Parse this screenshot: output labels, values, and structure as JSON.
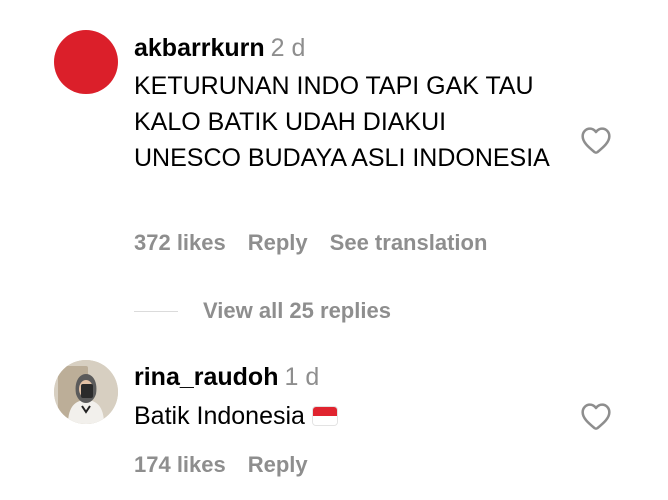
{
  "comments": [
    {
      "username": "akbarrkurn",
      "time": "2 d",
      "text": "KETURUNAN INDO TAPI GAK TAU KALO BATIK UDAH DIAKUI UNESCO BUDAYA ASLI INDONESIA",
      "likes": "372 likes",
      "reply_label": "Reply",
      "translate_label": "See translation",
      "avatar_color": "#db1f2a",
      "view_replies": "View all 25 replies"
    },
    {
      "username": "rina_raudoh",
      "time": "1 d",
      "text": "Batik Indonesia",
      "emoji": "flag-indonesia-icon",
      "likes": "174 likes",
      "reply_label": "Reply"
    }
  ],
  "icons": {
    "like": "heart-outline-icon"
  },
  "colors": {
    "muted": "#8e8e8e",
    "divider": "#dbdbdb"
  }
}
